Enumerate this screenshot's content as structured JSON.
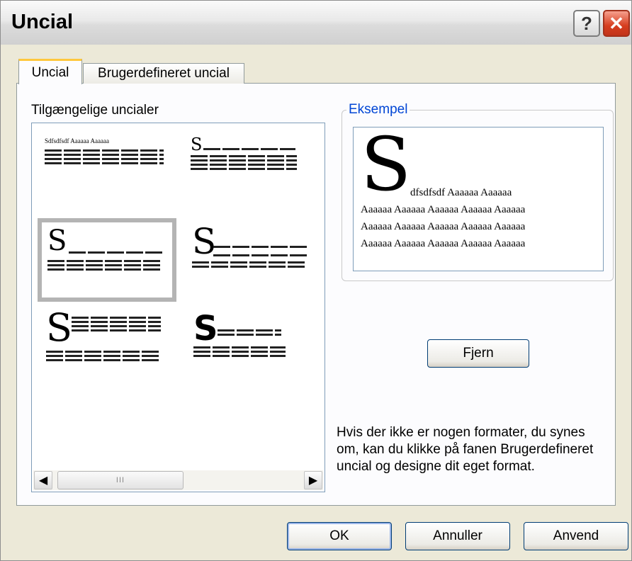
{
  "window": {
    "title": "Uncial",
    "help_glyph": "?",
    "close_glyph": "✕"
  },
  "tabs": [
    {
      "label": "Uncial"
    },
    {
      "label": "Brugerdefineret uncial"
    }
  ],
  "available": {
    "label": "Tilgængelige uncialer",
    "styles": [
      {
        "initial": "",
        "first_line": "Sdfsdfsdf Aaaaaa Aaaaaa"
      },
      {
        "initial": "S",
        "first_line": ""
      },
      {
        "initial": "S",
        "first_line": ""
      },
      {
        "initial": "S",
        "first_line": ""
      },
      {
        "initial": "S",
        "first_line": ""
      },
      {
        "initial": "S",
        "first_line": ""
      }
    ],
    "scroll_grip": "III"
  },
  "example": {
    "legend": "Eksempel",
    "initial": "S",
    "first_line": "dfsdfsdf Aaaaaa Aaaaaa",
    "lines": [
      "Aaaaaa Aaaaaa Aaaaaa Aaaaaa Aaaaaa",
      "Aaaaaa Aaaaaa Aaaaaa Aaaaaa Aaaaaa",
      "Aaaaaa Aaaaaa Aaaaaa Aaaaaa Aaaaaa"
    ]
  },
  "buttons": {
    "remove": "Fjern",
    "ok": "OK",
    "cancel": "Annuller",
    "apply": "Anvend"
  },
  "info_text": "Hvis der ikke er nogen formater, du synes om, kan du klikke på fanen Brugerdefineret uncial og designe dit eget format."
}
